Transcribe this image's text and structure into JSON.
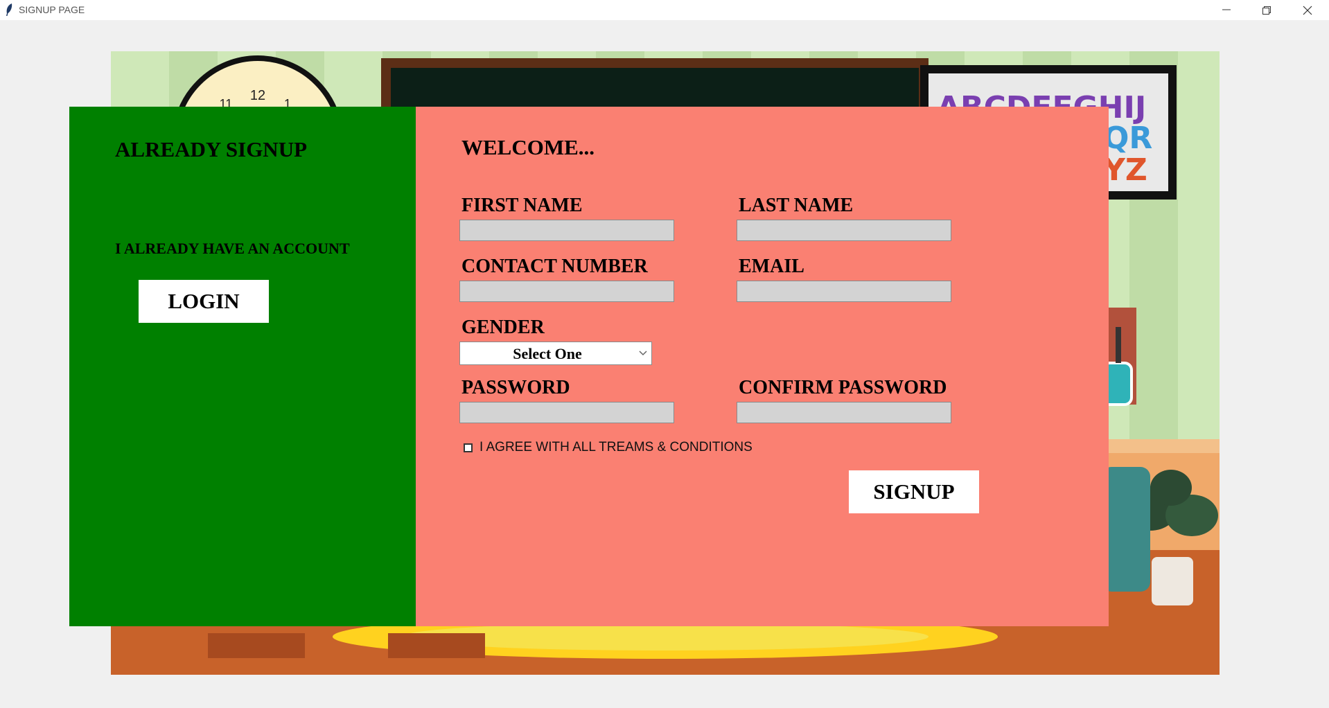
{
  "window": {
    "title": "SIGNUP PAGE",
    "controls": [
      "minimize-icon",
      "restore-icon",
      "close-icon"
    ]
  },
  "scene": {
    "clock_numbers": [
      "12",
      "11",
      "1"
    ],
    "alphabet_rows": [
      "ABCDEFGHIJ",
      "QR",
      "YZ"
    ]
  },
  "left_panel": {
    "title": "ALREADY SIGNUP",
    "subtitle": "I ALREADY HAVE AN ACCOUNT",
    "login_label": "LOGIN",
    "background": "#008000"
  },
  "form": {
    "title": "WELCOME...",
    "background": "#fa8072",
    "first_name": {
      "label": "FIRST NAME",
      "value": ""
    },
    "last_name": {
      "label": "LAST NAME",
      "value": ""
    },
    "contact": {
      "label": "CONTACT NUMBER",
      "value": ""
    },
    "email": {
      "label": "EMAIL",
      "value": ""
    },
    "gender": {
      "label": "GENDER",
      "selected": "Select One"
    },
    "password": {
      "label": "PASSWORD",
      "value": ""
    },
    "confirm_password": {
      "label": "CONFIRM PASSWORD",
      "value": ""
    },
    "terms": {
      "label": "I AGREE WITH ALL TREAMS & CONDITIONS",
      "checked": false
    },
    "signup_label": "SIGNUP"
  }
}
